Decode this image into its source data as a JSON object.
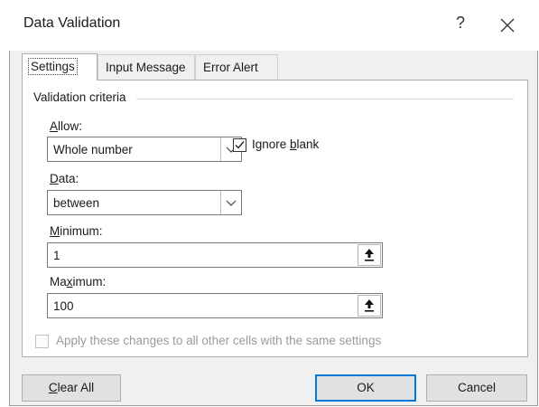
{
  "dialog": {
    "title": "Data Validation",
    "help_glyph": "?",
    "colors": {
      "accent": "#0078d7",
      "background": "#f0f0f0"
    }
  },
  "tabs": [
    {
      "pre": "",
      "u": "",
      "post": "Settings"
    },
    {
      "pre": "",
      "u": "",
      "post": "Input Message"
    },
    {
      "pre": "",
      "u": "",
      "post": "Error Alert"
    }
  ],
  "settings": {
    "group_title": "Validation criteria",
    "allow": {
      "label_u": "A",
      "label_rest": "llow:",
      "value": "Whole number"
    },
    "ignore_blank": {
      "pre": "Ignore ",
      "u": "b",
      "post": "lank",
      "checked": true
    },
    "data": {
      "label_u": "D",
      "label_rest": "ata:",
      "value": "between"
    },
    "minimum": {
      "label_u": "M",
      "label_rest": "inimum:",
      "value": "1"
    },
    "maximum": {
      "label_pre": "Ma",
      "label_u": "x",
      "label_rest": "imum:",
      "value": "100"
    },
    "apply_all": {
      "label": "Apply these changes to all other cells with the same settings",
      "checked": false,
      "enabled": false
    }
  },
  "buttons": {
    "clear_all": {
      "u": "C",
      "rest": "lear All"
    },
    "ok": "OK",
    "cancel": "Cancel"
  },
  "icons": [
    "help-icon",
    "close-icon",
    "chevron-down-icon",
    "collapse-dialog-icon",
    "checkmark-icon"
  ]
}
